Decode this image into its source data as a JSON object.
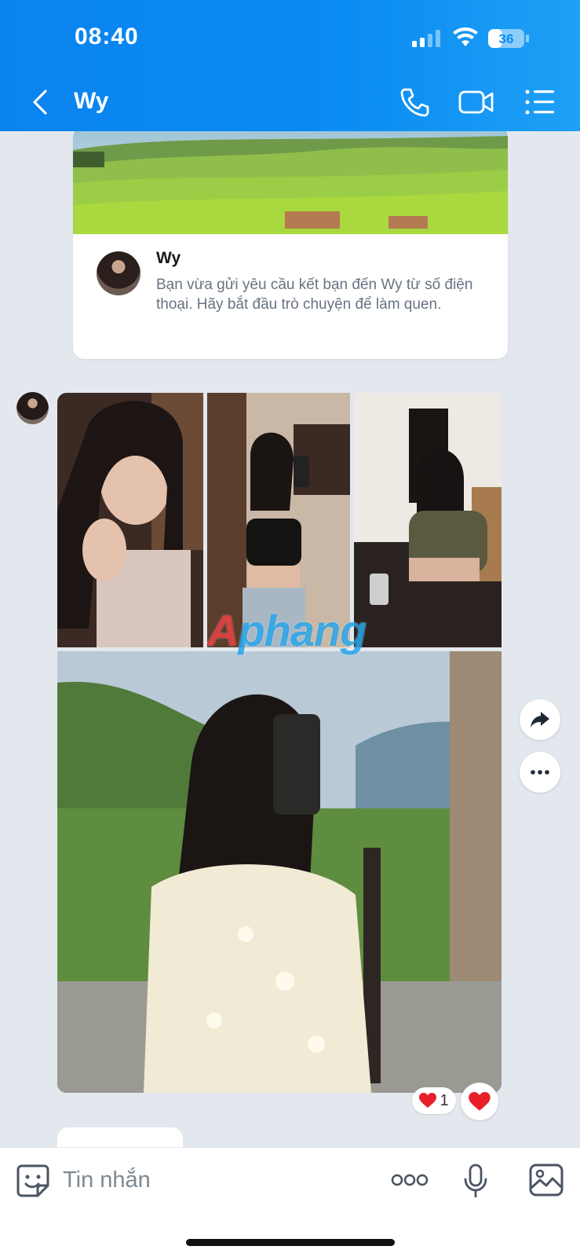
{
  "status_bar": {
    "time": "08:40",
    "battery": "36"
  },
  "header": {
    "back_icon": "chevron-left-icon",
    "title": "Wy",
    "actions": [
      "phone-icon",
      "video-camera-icon",
      "list-menu-icon"
    ]
  },
  "profile_card": {
    "name": "Wy",
    "description": "Bạn vừa gửi yêu cầu kết bạn đến Wy từ số điện thoại. Hãy bắt đầu trò chuyện để làm quen."
  },
  "message": {
    "photo_count": 4,
    "watermark": {
      "prefix": "A",
      "text": "phang"
    },
    "side_actions": [
      "share-arrow-icon",
      "more-dots-icon"
    ],
    "reaction": {
      "emoji": "❤️",
      "count": "1"
    },
    "react_button_emoji": "❤️"
  },
  "input_bar": {
    "placeholder": "Tin nhắn",
    "icons": [
      "sticker-icon",
      "more-dots-icon",
      "microphone-icon",
      "image-icon"
    ]
  },
  "colors": {
    "header": "#0b8cf2",
    "background": "#e3e8ef",
    "heart": "#e8202a"
  }
}
